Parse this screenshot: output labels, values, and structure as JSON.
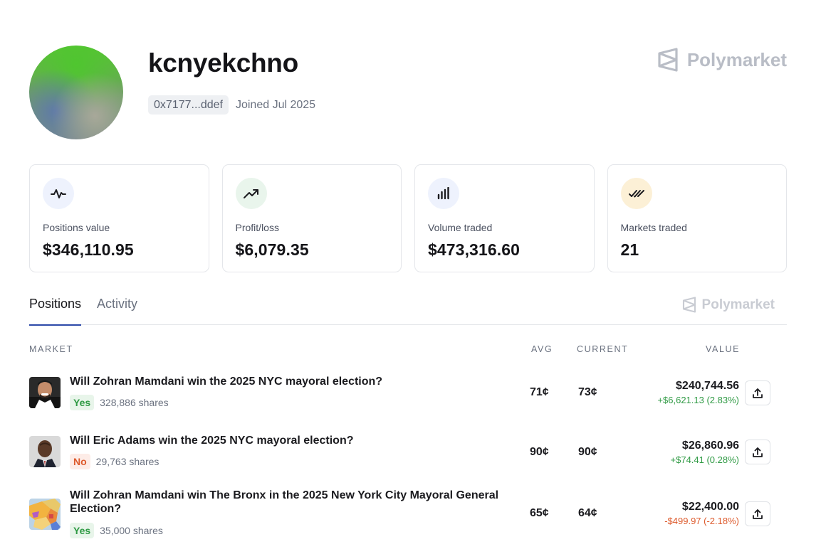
{
  "profile": {
    "username": "kcnyekchno",
    "address": "0x7177...ddef",
    "joined": "Joined Jul 2025"
  },
  "brand": {
    "name": "Polymarket"
  },
  "stats": [
    {
      "icon": "activity-icon",
      "label": "Positions value",
      "value": "$346,110.95",
      "color": "#eef2fd"
    },
    {
      "icon": "trending-up-icon",
      "label": "Profit/loss",
      "value": "$6,079.35",
      "color": "#e9f5ec"
    },
    {
      "icon": "bar-chart-icon",
      "label": "Volume traded",
      "value": "$473,316.60",
      "color": "#eef2fd"
    },
    {
      "icon": "double-check-icon",
      "label": "Markets traded",
      "value": "21",
      "color": "#fcf0d6"
    }
  ],
  "tabs": {
    "positions": "Positions",
    "activity": "Activity"
  },
  "table": {
    "headers": {
      "market": "MARKET",
      "avg": "AVG",
      "current": "CURRENT",
      "value": "VALUE"
    },
    "rows": [
      {
        "title": "Will Zohran Mamdani win the 2025 NYC mayoral election?",
        "outcome": "Yes",
        "shares": "328,886 shares",
        "avg": "71¢",
        "current": "73¢",
        "value": "$240,744.56",
        "change": "+$6,621.13 (2.83%)"
      },
      {
        "title": "Will Eric Adams win the 2025 NYC mayoral election?",
        "outcome": "No",
        "shares": "29,763 shares",
        "avg": "90¢",
        "current": "90¢",
        "value": "$26,860.96",
        "change": "+$74.41 (0.28%)"
      },
      {
        "title": "Will Zohran Mamdani win The Bronx in the 2025 New York City Mayoral General Election?",
        "outcome": "Yes",
        "shares": "35,000 shares",
        "avg": "65¢",
        "current": "64¢",
        "value": "$22,400.00",
        "change": "-$499.97 (-2.18%)"
      }
    ]
  },
  "colors": {
    "positive": "#2f9a44",
    "negative": "#dd5a2c",
    "tab_underline": "#2c4aa8"
  }
}
